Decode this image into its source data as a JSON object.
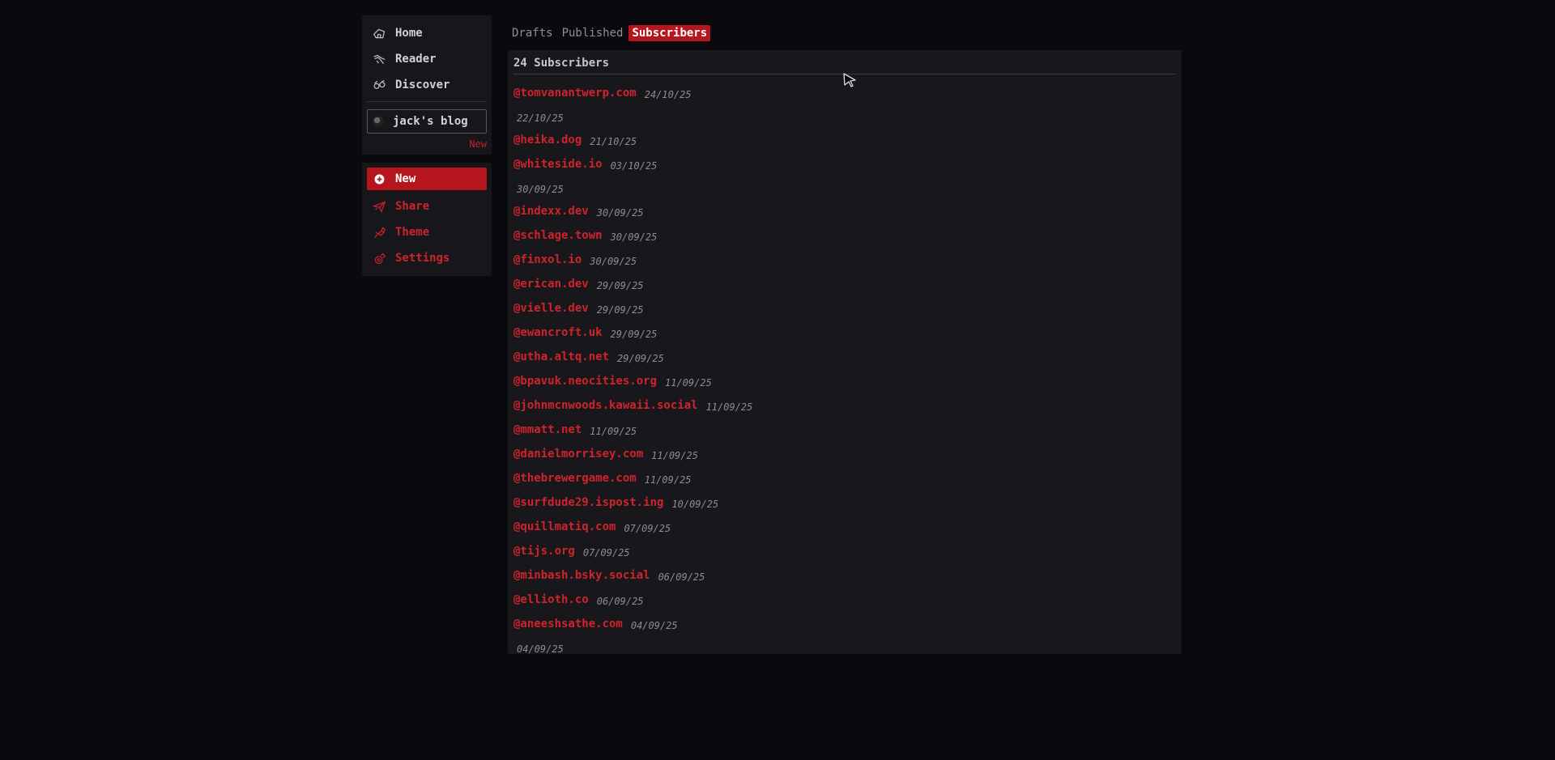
{
  "sidebar": {
    "nav": [
      {
        "label": "Home",
        "icon": "home-icon"
      },
      {
        "label": "Reader",
        "icon": "reader-icon"
      },
      {
        "label": "Discover",
        "icon": "discover-icon"
      }
    ],
    "blog": {
      "name": "jack's blog",
      "new_label": "New"
    },
    "actions": [
      {
        "label": "New",
        "icon": "plus-circle-icon"
      },
      {
        "label": "Share",
        "icon": "paper-plane-icon"
      },
      {
        "label": "Theme",
        "icon": "brush-icon"
      },
      {
        "label": "Settings",
        "icon": "gear-icon"
      }
    ]
  },
  "tabs": [
    "Drafts",
    "Published",
    "Subscribers"
  ],
  "active_tab": "Subscribers",
  "subscribers_heading": "24 Subscribers",
  "subscribers": [
    {
      "handle": "@tomvanantwerp.com",
      "date": "24/10/25"
    },
    {
      "handle": "",
      "date": "22/10/25"
    },
    {
      "handle": "@heika.dog",
      "date": "21/10/25"
    },
    {
      "handle": "@whiteside.io",
      "date": "03/10/25"
    },
    {
      "handle": "",
      "date": "30/09/25"
    },
    {
      "handle": "@indexx.dev",
      "date": "30/09/25"
    },
    {
      "handle": "@schlage.town",
      "date": "30/09/25"
    },
    {
      "handle": "@finxol.io",
      "date": "30/09/25"
    },
    {
      "handle": "@erican.dev",
      "date": "29/09/25"
    },
    {
      "handle": "@vielle.dev",
      "date": "29/09/25"
    },
    {
      "handle": "@ewancroft.uk",
      "date": "29/09/25"
    },
    {
      "handle": "@utha.altq.net",
      "date": "29/09/25"
    },
    {
      "handle": "@bpavuk.neocities.org",
      "date": "11/09/25"
    },
    {
      "handle": "@johnmcnwoods.kawaii.social",
      "date": "11/09/25"
    },
    {
      "handle": "@mmatt.net",
      "date": "11/09/25"
    },
    {
      "handle": "@danielmorrisey.com",
      "date": "11/09/25"
    },
    {
      "handle": "@thebrewergame.com",
      "date": "11/09/25"
    },
    {
      "handle": "@surfdude29.ispost.ing",
      "date": "10/09/25"
    },
    {
      "handle": "@quillmatiq.com",
      "date": "07/09/25"
    },
    {
      "handle": "@tijs.org",
      "date": "07/09/25"
    },
    {
      "handle": "@minbash.bsky.social",
      "date": "06/09/25"
    },
    {
      "handle": "@ellioth.co",
      "date": "06/09/25"
    },
    {
      "handle": "@aneeshsathe.com",
      "date": "04/09/25"
    },
    {
      "handle": "",
      "date": "04/09/25"
    }
  ],
  "colors": {
    "accent": "#b5161d",
    "link": "#d0232b",
    "background": "#0a0a0e",
    "panel": "#17171c"
  }
}
